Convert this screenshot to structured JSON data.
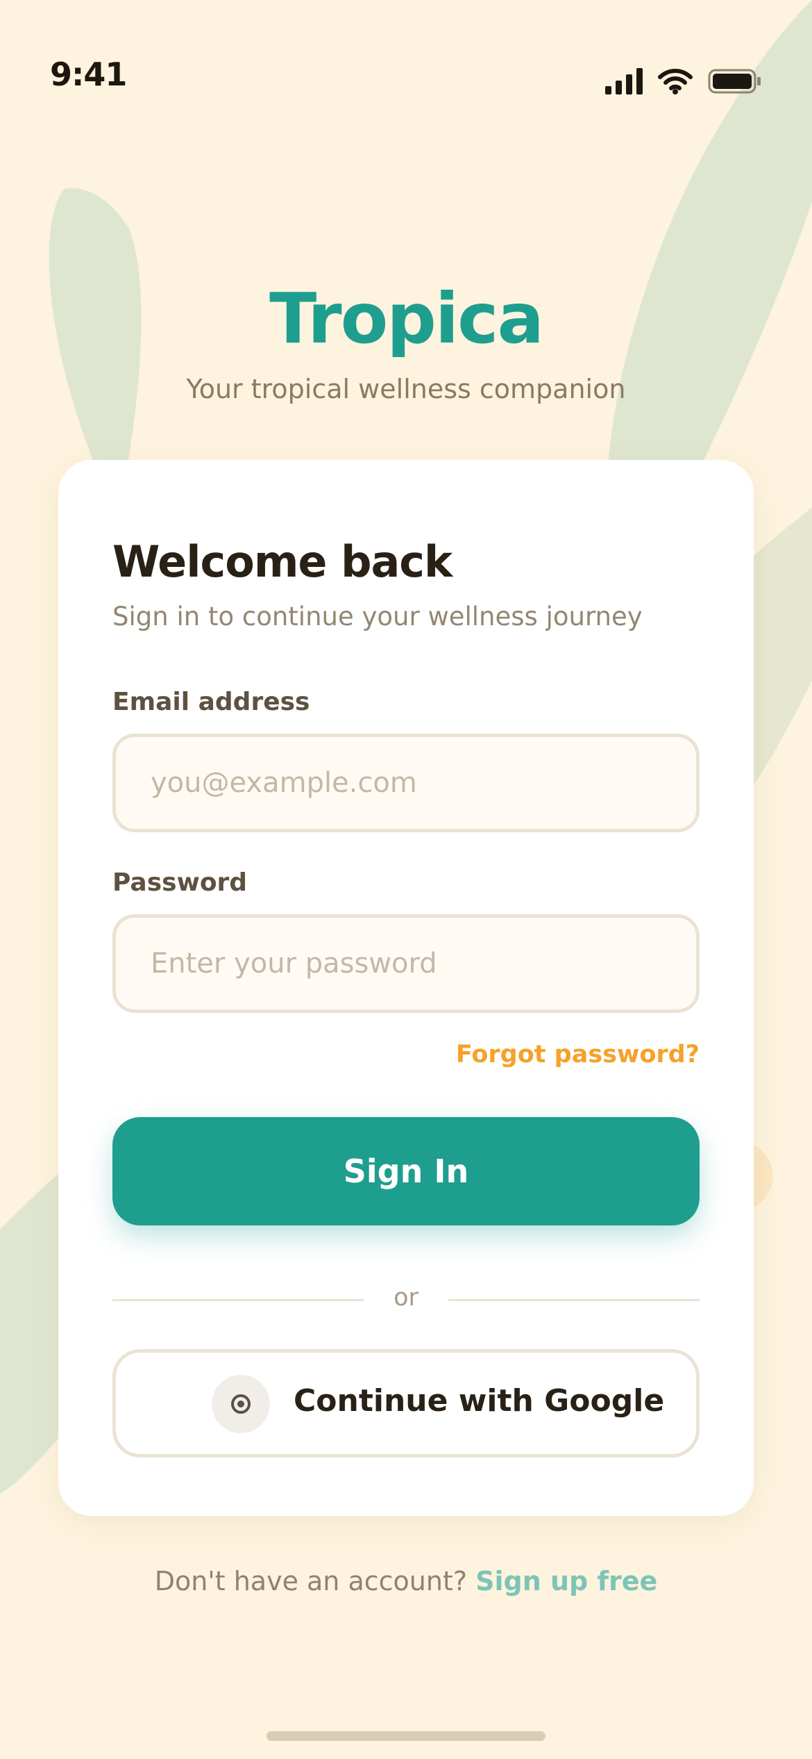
{
  "status_bar": {
    "time": "9:41",
    "icons": [
      "cellular-signal-icon",
      "wifi-icon",
      "battery-icon"
    ]
  },
  "brand": {
    "name": "Tropica",
    "tagline": "Your tropical wellness companion"
  },
  "card": {
    "title": "Welcome back",
    "subtitle": "Sign in to continue your wellness journey",
    "email": {
      "label": "Email address",
      "value": "",
      "placeholder": "you@example.com"
    },
    "password": {
      "label": "Password",
      "value": "",
      "placeholder": "Enter your password"
    },
    "forgot_label": "Forgot password?",
    "signin_label": "Sign In",
    "divider_text": "or",
    "google": {
      "icon": "google-icon",
      "label": "Continue with Google"
    }
  },
  "footer": {
    "prompt": "Don't have an account?",
    "signup_label": "Sign up free"
  },
  "colors": {
    "background": "#FDF3DE",
    "brand_teal": "#1E9E8E",
    "accent_orange": "#F5A12A",
    "leaf_green": "#DFE6D0",
    "signup_teal_light": "#7CC5B6",
    "card": "#FFFFFF",
    "input_border": "#EAE2D3"
  }
}
